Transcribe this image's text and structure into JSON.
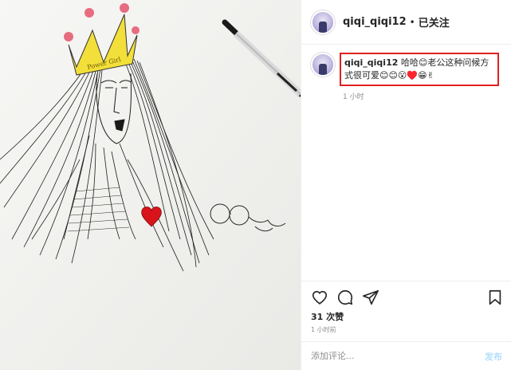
{
  "post": {
    "author": {
      "username": "qiqi_qiqi12",
      "separator": "•",
      "follow_label": "已关注"
    },
    "image": {
      "crown_text": "Power Girl"
    },
    "comment": {
      "username": "qiqi_qiqi12",
      "text": "哈哈😊老公这种问候方式很可爱😊😊😮♥️😁✌",
      "time": "1 小时"
    },
    "actions": {
      "like_icon": "heart-outline-icon",
      "comment_icon": "speech-bubble-icon",
      "share_icon": "paper-plane-icon",
      "save_icon": "bookmark-icon"
    },
    "likes_label": "31 次赞",
    "time_label": "1 小时前",
    "add_comment": {
      "placeholder": "添加评论...",
      "post_label": "发布"
    }
  },
  "colors": {
    "highlight": "#e02020",
    "crown": "#f2df3a",
    "heart": "#d8141a",
    "post_button_disabled": "#b2dffc"
  }
}
